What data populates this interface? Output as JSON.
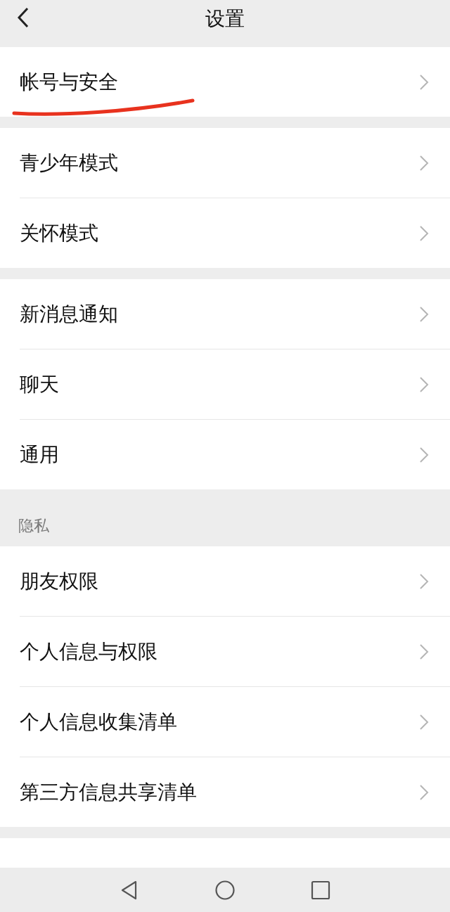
{
  "header": {
    "title": "设置"
  },
  "groups": [
    {
      "items": [
        {
          "label": "帐号与安全",
          "annotated": true
        }
      ]
    },
    {
      "items": [
        {
          "label": "青少年模式",
          "annotated": false
        },
        {
          "label": "关怀模式",
          "annotated": false
        }
      ]
    },
    {
      "items": [
        {
          "label": "新消息通知",
          "annotated": false
        },
        {
          "label": "聊天",
          "annotated": false
        },
        {
          "label": "通用",
          "annotated": false
        }
      ]
    },
    {
      "header": "隐私",
      "items": [
        {
          "label": "朋友权限",
          "annotated": false
        },
        {
          "label": "个人信息与权限",
          "annotated": false
        },
        {
          "label": "个人信息收集清单",
          "annotated": false
        },
        {
          "label": "第三方信息共享清单",
          "annotated": false
        }
      ]
    }
  ]
}
